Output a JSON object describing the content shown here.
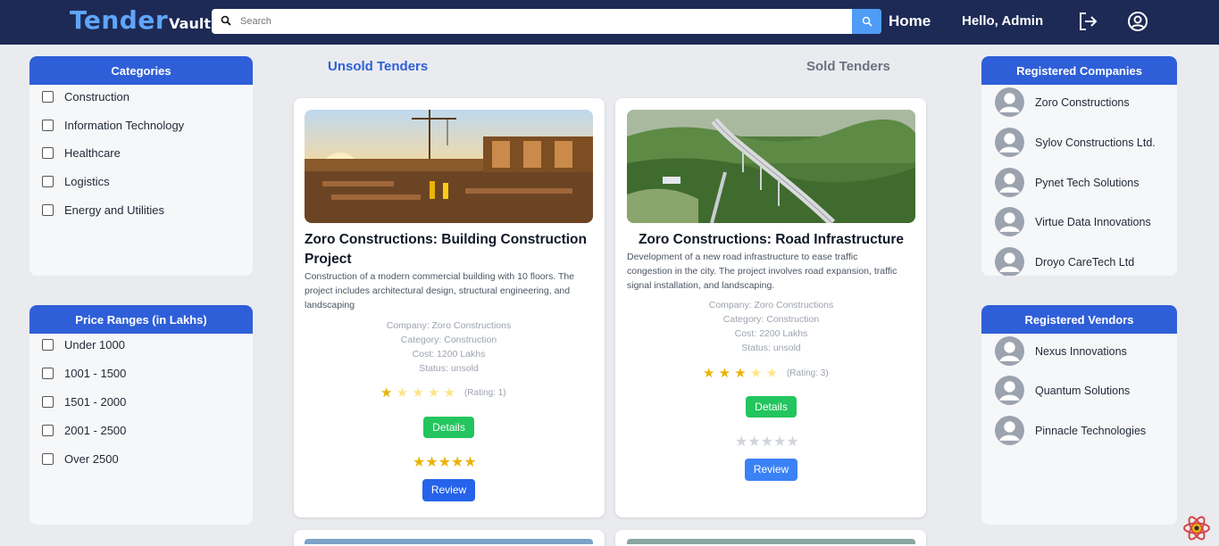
{
  "brand": {
    "name_big": "Tender",
    "name_small": "Vault"
  },
  "search": {
    "placeholder": "Search"
  },
  "nav": {
    "home": "Home",
    "greeting": "Hello, Admin"
  },
  "tabs": {
    "unsold": "Unsold Tenders",
    "sold": "Sold Tenders"
  },
  "categories": {
    "title": "Categories",
    "items": [
      "Construction",
      "Information Technology",
      "Healthcare",
      "Logistics",
      "Energy and Utilities"
    ]
  },
  "price_ranges": {
    "title": "Price Ranges (in Lakhs)",
    "items": [
      "Under 1000",
      "1001 - 1500",
      "1501 - 2000",
      "2001 - 2500",
      "Over 2500"
    ]
  },
  "registered_companies": {
    "title": "Registered Companies",
    "items": [
      "Zoro Constructions",
      "Sylov Constructions Ltd.",
      "Pynet Tech Solutions",
      "Virtue Data Innovations",
      "Droyo CareTech Ltd"
    ]
  },
  "registered_vendors": {
    "title": "Registered Vendors",
    "items": [
      "Nexus Innovations",
      "Quantum Solutions",
      "Pinnacle Technologies"
    ]
  },
  "tenders": [
    {
      "title": "Zoro Constructions: Building Construction Project",
      "description": "Construction of a modern commercial building with 10 floors. The project includes architectural design, structural engineering, and landscaping",
      "company": "Company: Zoro Constructions",
      "category": "Category: Construction",
      "cost": "Cost: 1200 Lakhs",
      "status": "Status: unsold",
      "rating_text": "(Rating: 1)",
      "rating": 1,
      "details_label": "Details",
      "review_label": "Review",
      "review_stars": 5
    },
    {
      "title": "Zoro Constructions: Road Infrastructure",
      "description": "Development of a new road infrastructure to ease traffic congestion in the city. The project involves road expansion, traffic signal installation, and landscaping.",
      "company": "Company: Zoro Constructions",
      "category": "Category: Construction",
      "cost": "Cost: 2200 Lakhs",
      "status": "Status: unsold",
      "rating_text": "(Rating: 3)",
      "rating": 3,
      "details_label": "Details",
      "review_label": "Review",
      "review_stars": 0
    }
  ],
  "colors": {
    "navbar": "#1d2a55",
    "panel_header": "#2f5fd8",
    "details_button": "#22c55e",
    "review_button": "#2563eb",
    "star": "#eab308",
    "brand": "#60a5fa"
  }
}
